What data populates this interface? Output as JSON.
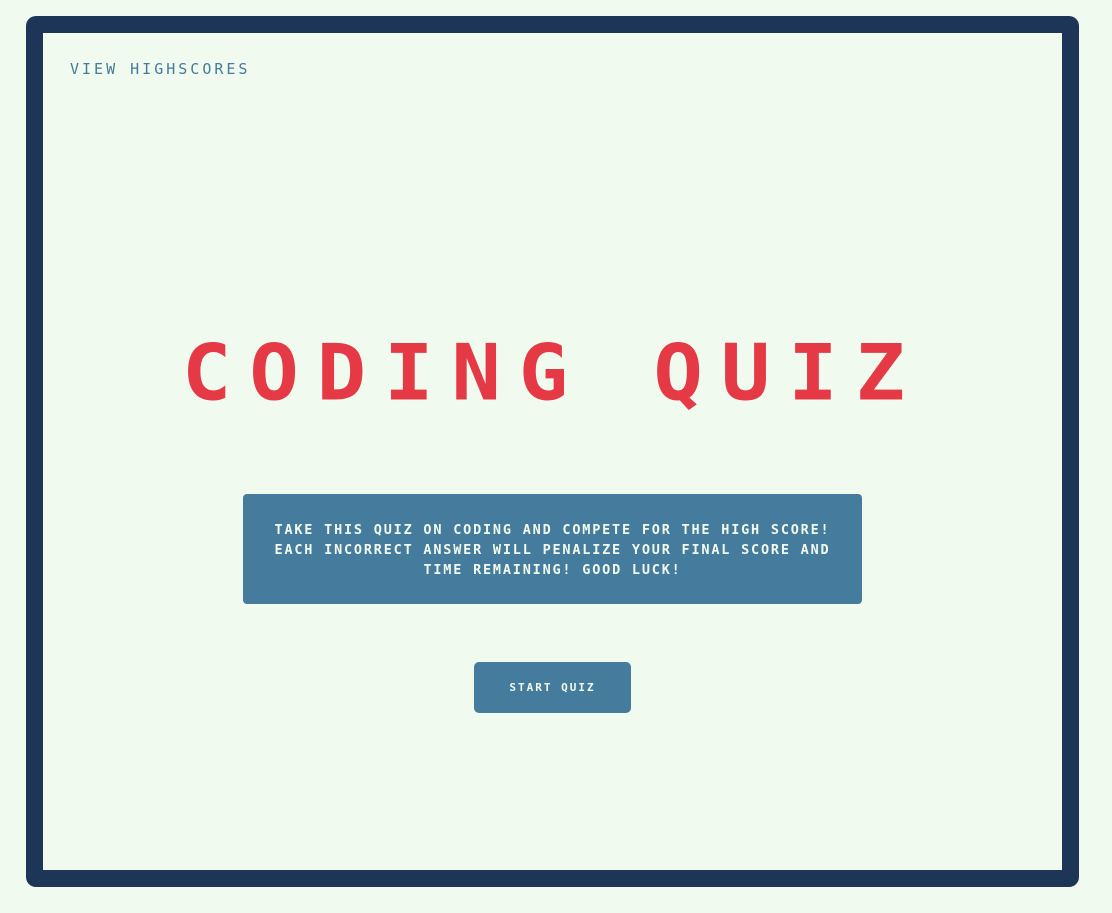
{
  "header": {
    "highscores_link": "View Highscores"
  },
  "main": {
    "title": "Coding Quiz",
    "intro": "Take this quiz on coding and compete for the high score! Each incorrect answer will penalize your final score and time remaining! Good luck!",
    "start_button": "Start Quiz"
  },
  "colors": {
    "background": "#f1faee",
    "frame": "#1d3557",
    "accent": "#457b9d",
    "title": "#e63946"
  }
}
